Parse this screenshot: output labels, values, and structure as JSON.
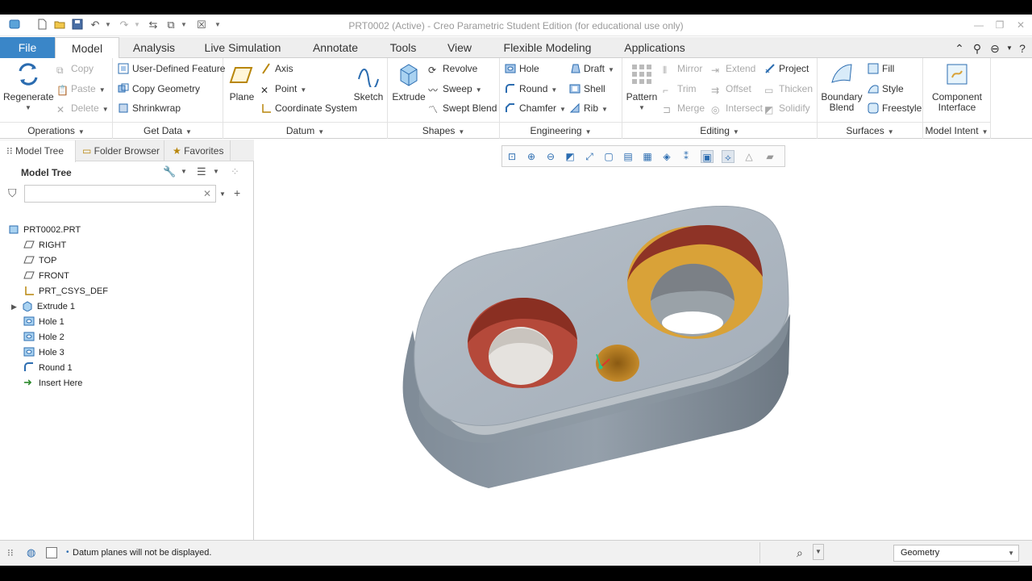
{
  "window": {
    "title": "PRT0002 (Active) - Creo Parametric Student Edition (for educational use only)"
  },
  "tabs": [
    "File",
    "Model",
    "Analysis",
    "Live Simulation",
    "Annotate",
    "Tools",
    "View",
    "Flexible Modeling",
    "Applications"
  ],
  "ribbon": {
    "operations": {
      "label": "Operations",
      "regenerate": "Regenerate",
      "copy": "Copy",
      "paste": "Paste",
      "delete": "Delete"
    },
    "get_data": {
      "label": "Get Data",
      "udf": "User-Defined Feature",
      "copy_geometry": "Copy Geometry",
      "shrinkwrap": "Shrinkwrap"
    },
    "datum": {
      "label": "Datum",
      "plane": "Plane",
      "axis": "Axis",
      "point": "Point",
      "csys": "Coordinate System",
      "sketch": "Sketch"
    },
    "shapes": {
      "label": "Shapes",
      "extrude": "Extrude",
      "revolve": "Revolve",
      "sweep": "Sweep",
      "swept_blend": "Swept Blend"
    },
    "engineering": {
      "label": "Engineering",
      "hole": "Hole",
      "round": "Round",
      "chamfer": "Chamfer",
      "draft": "Draft",
      "shell": "Shell",
      "rib": "Rib"
    },
    "editing": {
      "label": "Editing",
      "pattern": "Pattern",
      "mirror": "Mirror",
      "trim": "Trim",
      "merge": "Merge",
      "extend": "Extend",
      "offset": "Offset",
      "intersect": "Intersect",
      "project": "Project",
      "thicken": "Thicken",
      "solidify": "Solidify"
    },
    "surfaces": {
      "label": "Surfaces",
      "boundary_blend_1": "Boundary",
      "boundary_blend_2": "Blend",
      "fill": "Fill",
      "style": "Style",
      "freestyle": "Freestyle"
    },
    "model_intent": {
      "label": "Model Intent",
      "component_1": "Component",
      "component_2": "Interface"
    }
  },
  "left_tabs": [
    "Model Tree",
    "Folder Browser",
    "Favorites"
  ],
  "model_tree": {
    "heading": "Model Tree",
    "filter_value": "",
    "root": "PRT0002.PRT",
    "items": [
      "RIGHT",
      "TOP",
      "FRONT",
      "PRT_CSYS_DEF",
      "Extrude 1",
      "Hole 1",
      "Hole 2",
      "Hole 3",
      "Round 1",
      "Insert Here"
    ]
  },
  "status": {
    "message": "Datum planes will not be displayed.",
    "selection_filter": "Geometry"
  },
  "colors": {
    "file_tab": "#3a86c8",
    "part_body": "#a7b1bc",
    "hole_red": "#b5493a",
    "hole_gold": "#d9a238"
  }
}
